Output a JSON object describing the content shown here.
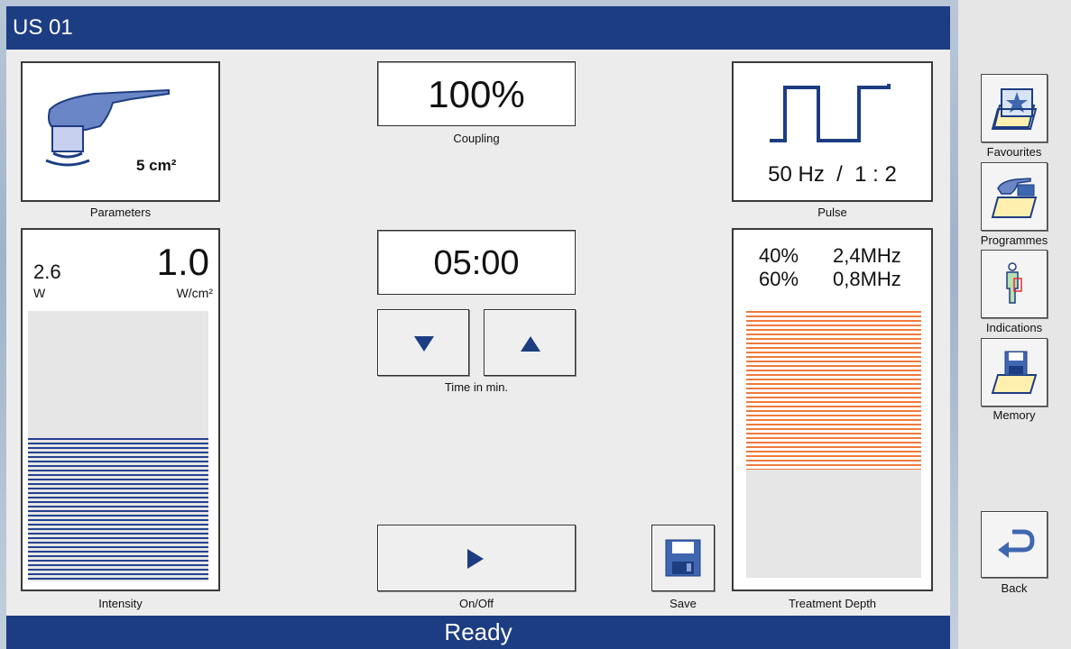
{
  "title": "US 01",
  "status": "Ready",
  "parameters": {
    "area": "5 cm²",
    "label": "Parameters"
  },
  "coupling": {
    "value": "100%",
    "label": "Coupling"
  },
  "pulse": {
    "value": "50 Hz  /  1 : 2",
    "label": "Pulse"
  },
  "intensity": {
    "power_value": "2.6",
    "power_unit": "W",
    "density_value": "1.0",
    "density_unit": "W/cm²",
    "level": 0.53,
    "label": "Intensity"
  },
  "timer": {
    "value": "05:00",
    "label": "Time in min."
  },
  "onoff": {
    "label": "On/Off"
  },
  "save": {
    "label": "Save"
  },
  "depth": {
    "row1_pct": "40%",
    "row1_freq": "2,4MHz",
    "row2_pct": "60%",
    "row2_freq": "0,8MHz",
    "label": "Treatment Depth"
  },
  "sidebar": {
    "favourites": "Favourites",
    "programmes": "Programmes",
    "indications": "Indications",
    "memory": "Memory",
    "back": "Back"
  },
  "colors": {
    "brand": "#1d3d82",
    "intensity_bar": "#24428f",
    "depth_bar": "#f07a3c"
  }
}
